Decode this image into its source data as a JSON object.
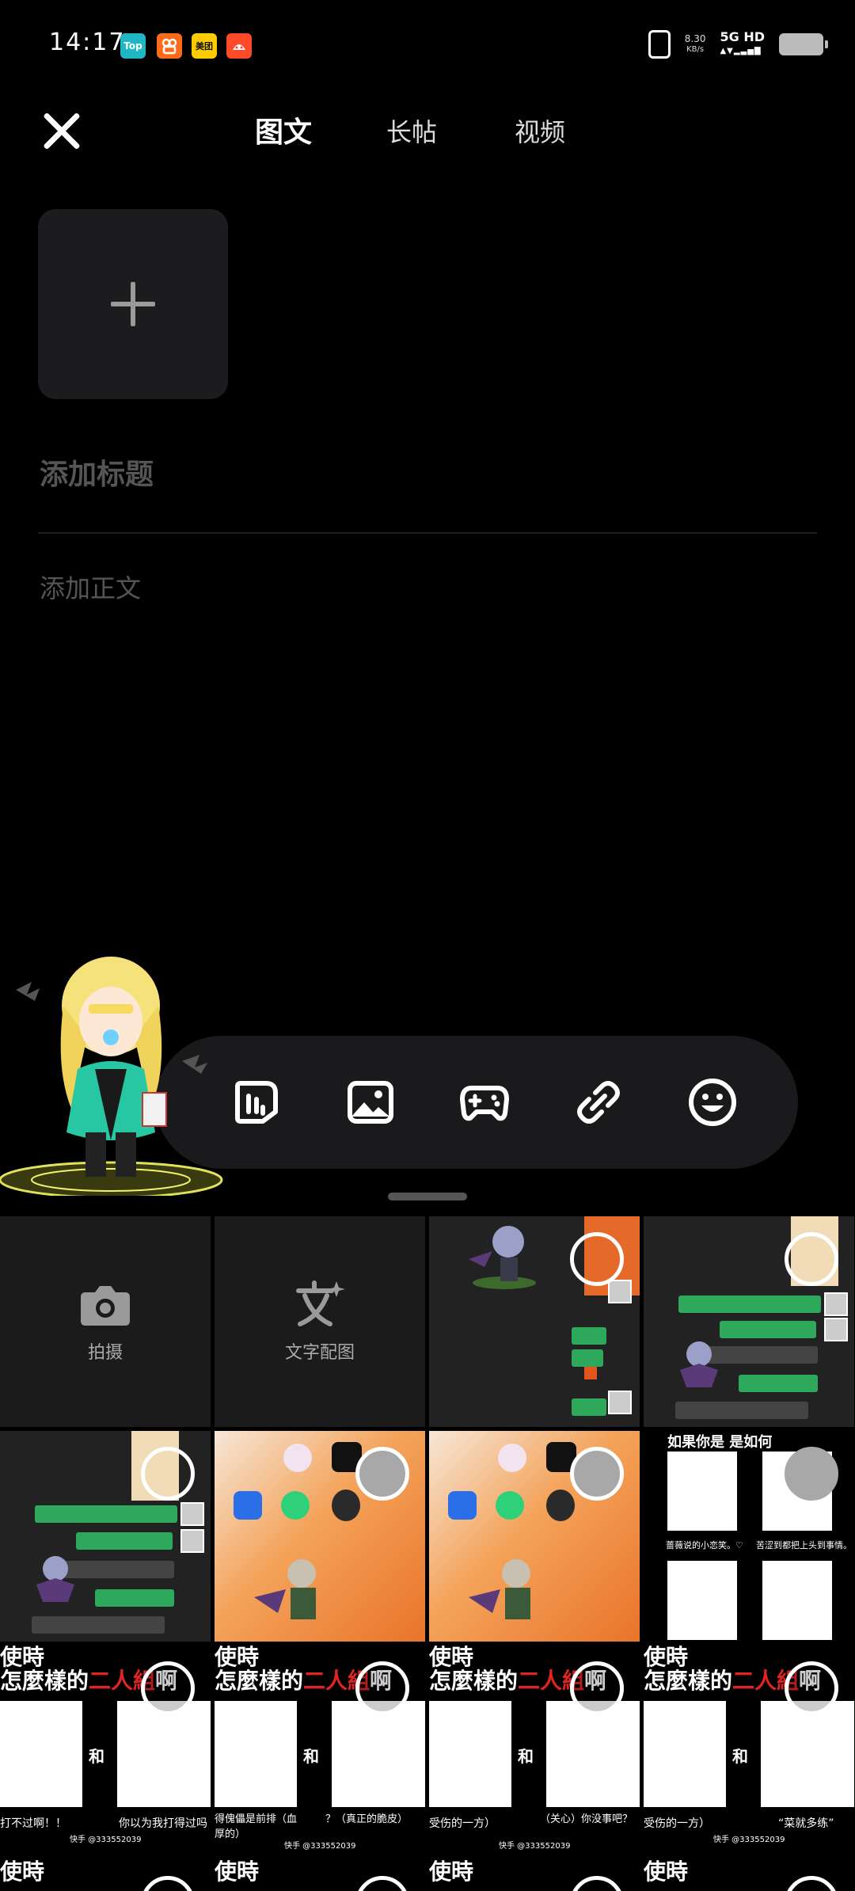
{
  "status_bar": {
    "time": "14:17",
    "apps": [
      {
        "name": "top-app-icon",
        "text": "Top",
        "color": "#20b7c4"
      },
      {
        "name": "kuaishou-icon",
        "text": "",
        "color": "#ff6a1a"
      },
      {
        "name": "meituan-icon",
        "text": "美团",
        "color": "#ffcc00"
      },
      {
        "name": "app-red-icon",
        "text": "",
        "color": "#ff4a2a"
      }
    ],
    "net_speed": "8.30",
    "net_unit": "KB/s",
    "signal": "5G HD"
  },
  "header": {
    "tabs": [
      {
        "label": "图文",
        "active": true
      },
      {
        "label": "长帖",
        "active": false
      },
      {
        "label": "视频",
        "active": false
      }
    ],
    "accent": "#19c3b6"
  },
  "editor": {
    "title_placeholder": "添加标题",
    "body_placeholder": "添加正文"
  },
  "toolbar": {
    "tools": [
      "sticker-icon",
      "image-icon",
      "gamepad-icon",
      "link-icon",
      "emoji-icon"
    ]
  },
  "gallery": {
    "camera_label": "拍摄",
    "text_to_image_label": "文字配图",
    "meme": {
      "line1": "使時",
      "line2a": "怎麼樣的",
      "line2b": "二人組",
      "line2c": "啊",
      "and": "和",
      "captions": [
        [
          "打不过啊！！",
          "你以为我打得过吗"
        ],
        [
          "得傀儡是前排（血厚的）",
          "？（真正的脆皮）"
        ],
        [
          "受伤的一方）",
          "（关心）你没事吧？"
        ],
        [
          "受伤的一方）",
          "“菜就多练”"
        ]
      ],
      "watermark": "快手 @333552039"
    },
    "album_caption_left": "蔷薇说的小恋笑。♡",
    "album_caption_right": "苦涩到都把上头到事情。",
    "album_header": "如果你是   是如何"
  }
}
